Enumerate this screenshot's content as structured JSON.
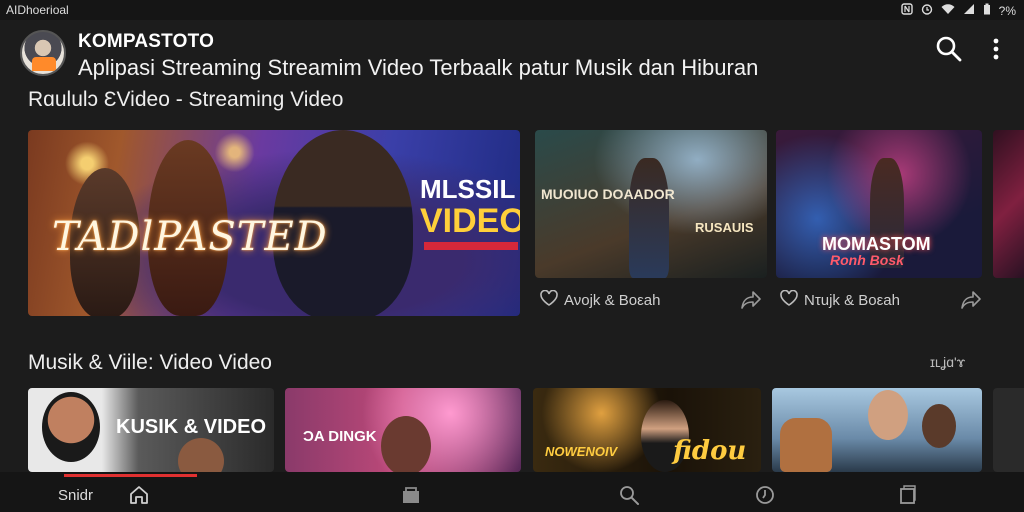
{
  "status": {
    "left_text": "AIDhoerioal",
    "icons": [
      "nfc-icon",
      "alarm-icon",
      "wifi-icon",
      "signal-icon",
      "battery-icon"
    ],
    "battery_text": "?%"
  },
  "header": {
    "app_name": "KOMPASTOTO",
    "subtitle": "Aplipasi Streaming Streamim Video Terbaalk patur Musik dan Hiburan"
  },
  "section1": {
    "title": "Rɑululɔ ƐVideo - Streaming Video",
    "hero": {
      "title_text": "TADlPASTED",
      "badge_line1": "MLSSIL",
      "badge_line2": "VIDEO"
    },
    "cards": [
      {
        "overlay_top": "MUOIUO DOAADOR",
        "overlay_bottom": "RUSAUIS",
        "meta": "Ανοjk & Βοεah"
      },
      {
        "overlay_top": "MOMASTOM",
        "overlay_bottom": "Ronh Bosk",
        "meta": "Ντujk & Βοεah"
      }
    ]
  },
  "section2": {
    "title": "Musik & Viile: Video Video",
    "see_all": "ɪʟʝɑʹɤ",
    "cards": [
      {
        "overlay": "KUSIK & VIDEO"
      },
      {
        "overlay": "ƆA DINGK"
      },
      {
        "overlay": "NOWENOIV",
        "overlay2": "fidou"
      },
      {
        "overlay": ""
      }
    ]
  },
  "bottom_nav": {
    "label": "Snidr",
    "playback_progress": 0.13,
    "items": [
      "home-icon",
      "library-icon",
      "search-icon",
      "history-icon",
      "collections-icon"
    ]
  },
  "colors": {
    "background": "#1c1c1c",
    "accent": "#e03030",
    "text": "#eeeeee"
  }
}
